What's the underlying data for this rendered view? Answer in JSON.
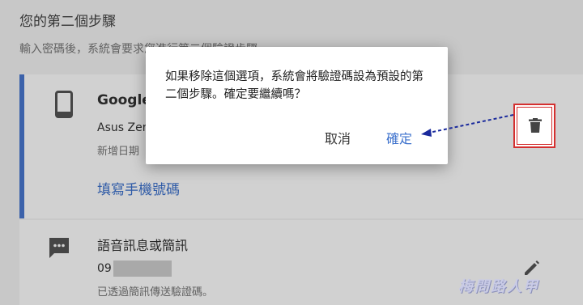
{
  "page": {
    "title": "您的第二個步驟",
    "description": "輸入密碼後，系統會要求您進行第二個驗證步驟"
  },
  "authenticator": {
    "title": "Google",
    "device": "Asus Zen",
    "added": "新增日期",
    "link": "填寫手機號碼",
    "icon": "phone-icon"
  },
  "sms": {
    "title": "語音訊息或簡訊",
    "phone_prefix": "09",
    "description": "已透過簡訊傳送驗證碼。",
    "icon": "message-icon"
  },
  "dialog": {
    "message": "如果移除這個選項，系統會將驗證碼設為預設的第二個步驟。確定要繼續嗎？",
    "cancel_label": "取消",
    "confirm_label": "確定"
  },
  "annotation": {
    "highlight_color": "#d42f2f",
    "arrow_color": "#1a2a9c",
    "target_icon": "trash-icon"
  },
  "watermark": {
    "text": "梅問路人甲"
  },
  "colors": {
    "accent": "#3a6fcc",
    "card_bar": "#4a78d0"
  }
}
